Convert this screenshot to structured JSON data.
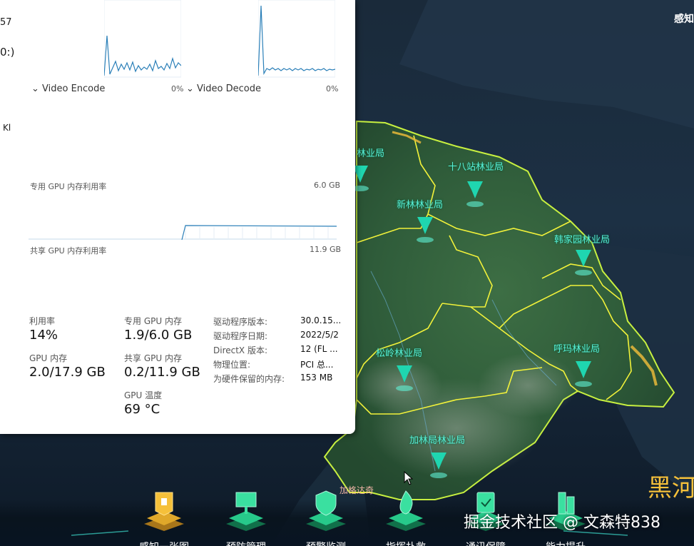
{
  "taskmgr": {
    "cut_texts": [
      "57",
      "0:)",
      "Kl"
    ],
    "engines": [
      {
        "label": "Video Encode",
        "percent": "0%"
      },
      {
        "label": "Video Decode",
        "percent": "0%"
      }
    ],
    "dedicated_mem": {
      "label": "专用 GPU 内存利用率",
      "max": "6.0 GB"
    },
    "shared_mem": {
      "label": "共享 GPU 内存利用率",
      "max": "11.9 GB"
    },
    "stats": {
      "utilization": {
        "label": "利用率",
        "value": "14%"
      },
      "dedicated": {
        "label": "专用 GPU 内存",
        "value": "1.9/6.0 GB"
      },
      "gpu_memory": {
        "label": "GPU 内存",
        "value": "2.0/17.9 GB"
      },
      "shared": {
        "label": "共享 GPU 内存",
        "value": "0.2/11.9 GB"
      },
      "temperature": {
        "label": "GPU 温度",
        "value": "69 °C"
      }
    },
    "properties": [
      {
        "key": "驱动程序版本:",
        "value": "30.0.15..."
      },
      {
        "key": "驱动程序日期:",
        "value": "2022/5/2"
      },
      {
        "key": "DirectX 版本:",
        "value": "12 (FL ..."
      },
      {
        "key": "物理位置:",
        "value": "PCI 总..."
      },
      {
        "key": "为硬件保留的内存:",
        "value": "153 MB"
      }
    ]
  },
  "map": {
    "top_right_title": "感知",
    "big_title": "黑河",
    "town_label": "加格达奇",
    "bureaus": [
      "林业局",
      "十八站林业局",
      "新林林业局",
      "韩家园林业局",
      "松岭林业局",
      "呼玛林业局",
      "加林局林业局"
    ]
  },
  "nav": {
    "items": [
      "感知一张图",
      "预防管理",
      "预警监测",
      "指挥扑救",
      "通讯保障",
      "能力提升"
    ]
  },
  "watermark": "掘金技术社区 @ 文森特838",
  "colors": {
    "accent_cyan": "#58f0d8",
    "boundary_yellow": "#f2f23a",
    "nav_gold": "#f5c03a",
    "nav_green": "#27c98a"
  }
}
